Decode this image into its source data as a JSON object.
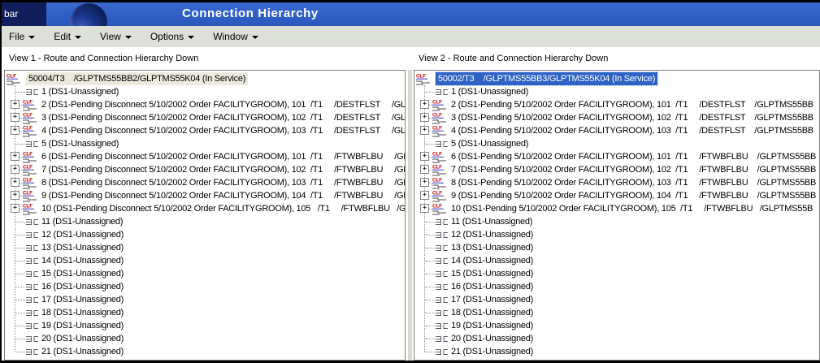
{
  "titlebar": {
    "corner_text": "bar",
    "title": "Connection Hierarchy"
  },
  "menubar": {
    "items": [
      {
        "label": "File"
      },
      {
        "label": "Edit"
      },
      {
        "label": "View"
      },
      {
        "label": "Options"
      },
      {
        "label": "Window"
      }
    ]
  },
  "icons": {
    "clf_text": "CLF",
    "expand_glyph": "+"
  },
  "colors": {
    "titlebar_blue": "#2e5ec4",
    "corner_navy": "#101f5c",
    "menu_bg": "#dce0d8",
    "selection_active": "#2e62c4",
    "selection_inactive": "#eceade",
    "clf_red": "#cc0000",
    "clf_blue": "#3333cc"
  },
  "views": [
    {
      "header": "View 1 - Route and Connection Hierarchy Down",
      "root_label": "50004/T3    /GLPTMS55BB2/GLPTMS55K04 (In Service)",
      "root_state": "sel-inactive",
      "nodes": [
        {
          "label": "1 (DS1-Unassigned)",
          "type": "ds1"
        },
        {
          "label": "2 (DS1-Pending Disconnect 5/10/2002 Order FACILITYGROOM), 101  /T1     /DESTFLST     /GL",
          "type": "clf"
        },
        {
          "label": "3 (DS1-Pending Disconnect 5/10/2002 Order FACILITYGROOM), 102  /T1     /DESTFLST     /GL",
          "type": "clf"
        },
        {
          "label": "4 (DS1-Pending Disconnect 5/10/2002 Order FACILITYGROOM), 103  /T1     /DESTFLST     /GL",
          "type": "clf"
        },
        {
          "label": "5 (DS1-Unassigned)",
          "type": "ds1"
        },
        {
          "label": "6 (DS1-Pending Disconnect 5/10/2002 Order FACILITYGROOM), 101  /T1     /FTWBFLBU     /GL",
          "type": "clf"
        },
        {
          "label": "7 (DS1-Pending Disconnect 5/10/2002 Order FACILITYGROOM), 102  /T1     /FTWBFLBU     /GL",
          "type": "clf"
        },
        {
          "label": "8 (DS1-Pending Disconnect 5/10/2002 Order FACILITYGROOM), 103  /T1     /FTWBFLBU     /GL",
          "type": "clf"
        },
        {
          "label": "9 (DS1-Pending Disconnect 5/10/2002 Order FACILITYGROOM), 104  /T1     /FTWBFLBU     /GL",
          "type": "clf"
        },
        {
          "label": "10 (DS1-Pending Disconnect 5/10/2002 Order FACILITYGROOM), 105   /T1     /FTWBFLBU   /G",
          "type": "clf"
        },
        {
          "label": "11 (DS1-Unassigned)",
          "type": "ds1"
        },
        {
          "label": "12 (DS1-Unassigned)",
          "type": "ds1"
        },
        {
          "label": "13 (DS1-Unassigned)",
          "type": "ds1"
        },
        {
          "label": "14 (DS1-Unassigned)",
          "type": "ds1"
        },
        {
          "label": "15 (DS1-Unassigned)",
          "type": "ds1"
        },
        {
          "label": "16 (DS1-Unassigned)",
          "type": "ds1"
        },
        {
          "label": "17 (DS1-Unassigned)",
          "type": "ds1"
        },
        {
          "label": "18 (DS1-Unassigned)",
          "type": "ds1"
        },
        {
          "label": "19 (DS1-Unassigned)",
          "type": "ds1"
        },
        {
          "label": "20 (DS1-Unassigned)",
          "type": "ds1"
        },
        {
          "label": "21 (DS1-Unassigned)",
          "type": "ds1"
        }
      ]
    },
    {
      "header": "View 2 - Route and Connection Hierarchy Down",
      "root_label": "50002/T3    /GLPTMS55BB3/GLPTMS55K04 (In Service)",
      "root_state": "sel-active",
      "nodes": [
        {
          "label": "1 (DS1-Unassigned)",
          "type": "ds1"
        },
        {
          "label": "2 (DS1-Pending 5/10/2002 Order FACILITYGROOM), 101  /T1     /DESTFLST    /GLPTMS55BB",
          "type": "clf"
        },
        {
          "label": "3 (DS1-Pending 5/10/2002 Order FACILITYGROOM), 102  /T1     /DESTFLST    /GLPTMS55BB",
          "type": "clf"
        },
        {
          "label": "4 (DS1-Pending 5/10/2002 Order FACILITYGROOM), 103  /T1     /DESTFLST    /GLPTMS55BB",
          "type": "clf"
        },
        {
          "label": "5 (DS1-Unassigned)",
          "type": "ds1"
        },
        {
          "label": "6 (DS1-Pending 5/10/2002 Order FACILITYGROOM), 101  /T1     /FTWBFLBU    /GLPTMS55BB",
          "type": "clf"
        },
        {
          "label": "7 (DS1-Pending 5/10/2002 Order FACILITYGROOM), 102  /T1     /FTWBFLBU    /GLPTMS55BB",
          "type": "clf"
        },
        {
          "label": "8 (DS1-Pending 5/10/2002 Order FACILITYGROOM), 103  /T1     /FTWBFLBU    /GLPTMS55BB",
          "type": "clf"
        },
        {
          "label": "9 (DS1-Pending 5/10/2002 Order FACILITYGROOM), 104  /T1     /FTWBFLBU    /GLPTMS55BB",
          "type": "clf"
        },
        {
          "label": "10 (DS1-Pending 5/10/2002 Order FACILITYGROOM), 105  /T1     /FTWBFLBU   /GLPTMS55B",
          "type": "clf"
        },
        {
          "label": "11 (DS1-Unassigned)",
          "type": "ds1"
        },
        {
          "label": "12 (DS1-Unassigned)",
          "type": "ds1"
        },
        {
          "label": "13 (DS1-Unassigned)",
          "type": "ds1"
        },
        {
          "label": "14 (DS1-Unassigned)",
          "type": "ds1"
        },
        {
          "label": "15 (DS1-Unassigned)",
          "type": "ds1"
        },
        {
          "label": "16 (DS1-Unassigned)",
          "type": "ds1"
        },
        {
          "label": "17 (DS1-Unassigned)",
          "type": "ds1"
        },
        {
          "label": "18 (DS1-Unassigned)",
          "type": "ds1"
        },
        {
          "label": "19 (DS1-Unassigned)",
          "type": "ds1"
        },
        {
          "label": "20 (DS1-Unassigned)",
          "type": "ds1"
        },
        {
          "label": "21 (DS1-Unassigned)",
          "type": "ds1"
        }
      ]
    }
  ]
}
